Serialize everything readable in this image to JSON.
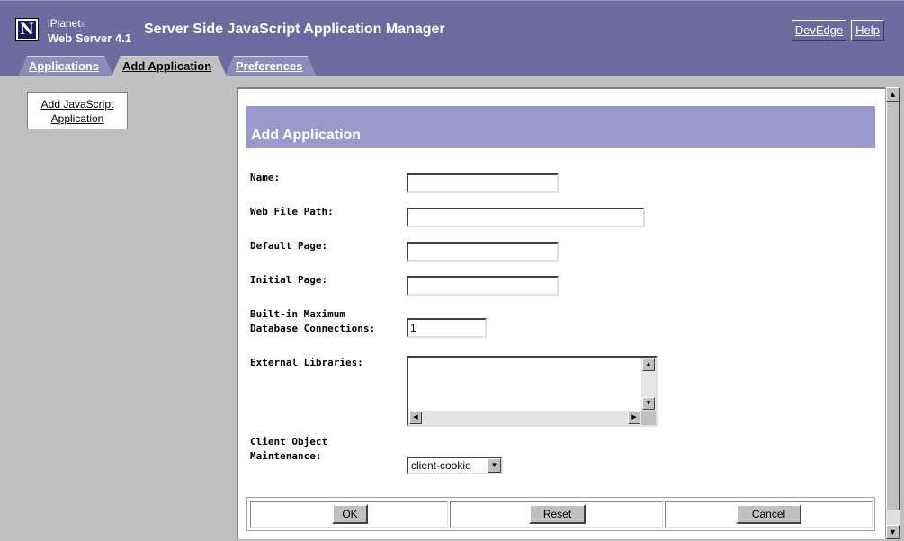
{
  "header": {
    "brand_top": "iPlanet",
    "brand_mark": "®",
    "brand_product": "Web Server 4.1",
    "logo_letter": "N",
    "title": "Server Side JavaScript Application Manager",
    "links": {
      "devedge": "DevEdge",
      "help": "Help"
    }
  },
  "tabs": [
    {
      "label": "Applications",
      "active": false
    },
    {
      "label": "Add Application",
      "active": true
    },
    {
      "label": "Preferences",
      "active": false
    }
  ],
  "sidebar": {
    "link_line1": "Add JavaScript",
    "link_line2": "Application"
  },
  "form": {
    "heading": "Add Application",
    "name": {
      "label": "Name:",
      "value": ""
    },
    "web_file_path": {
      "label": "Web File Path:",
      "value": ""
    },
    "default_page": {
      "label": "Default Page:",
      "value": ""
    },
    "initial_page": {
      "label": "Initial Page:",
      "value": ""
    },
    "max_db_connections": {
      "label_line1": "Built-in Maximum",
      "label_line2": "Database Connections:",
      "value": "1"
    },
    "external_libraries": {
      "label": "External Libraries:",
      "value": ""
    },
    "client_object": {
      "label_line1": "Client Object",
      "label_line2": "Maintenance:",
      "selected": "client-cookie"
    }
  },
  "buttons": {
    "ok": "OK",
    "reset": "Reset",
    "cancel": "Cancel"
  },
  "colors": {
    "header_bg": "#6b6b9f",
    "heading_bg": "#9999cc",
    "chrome": "#c0c0c0"
  }
}
